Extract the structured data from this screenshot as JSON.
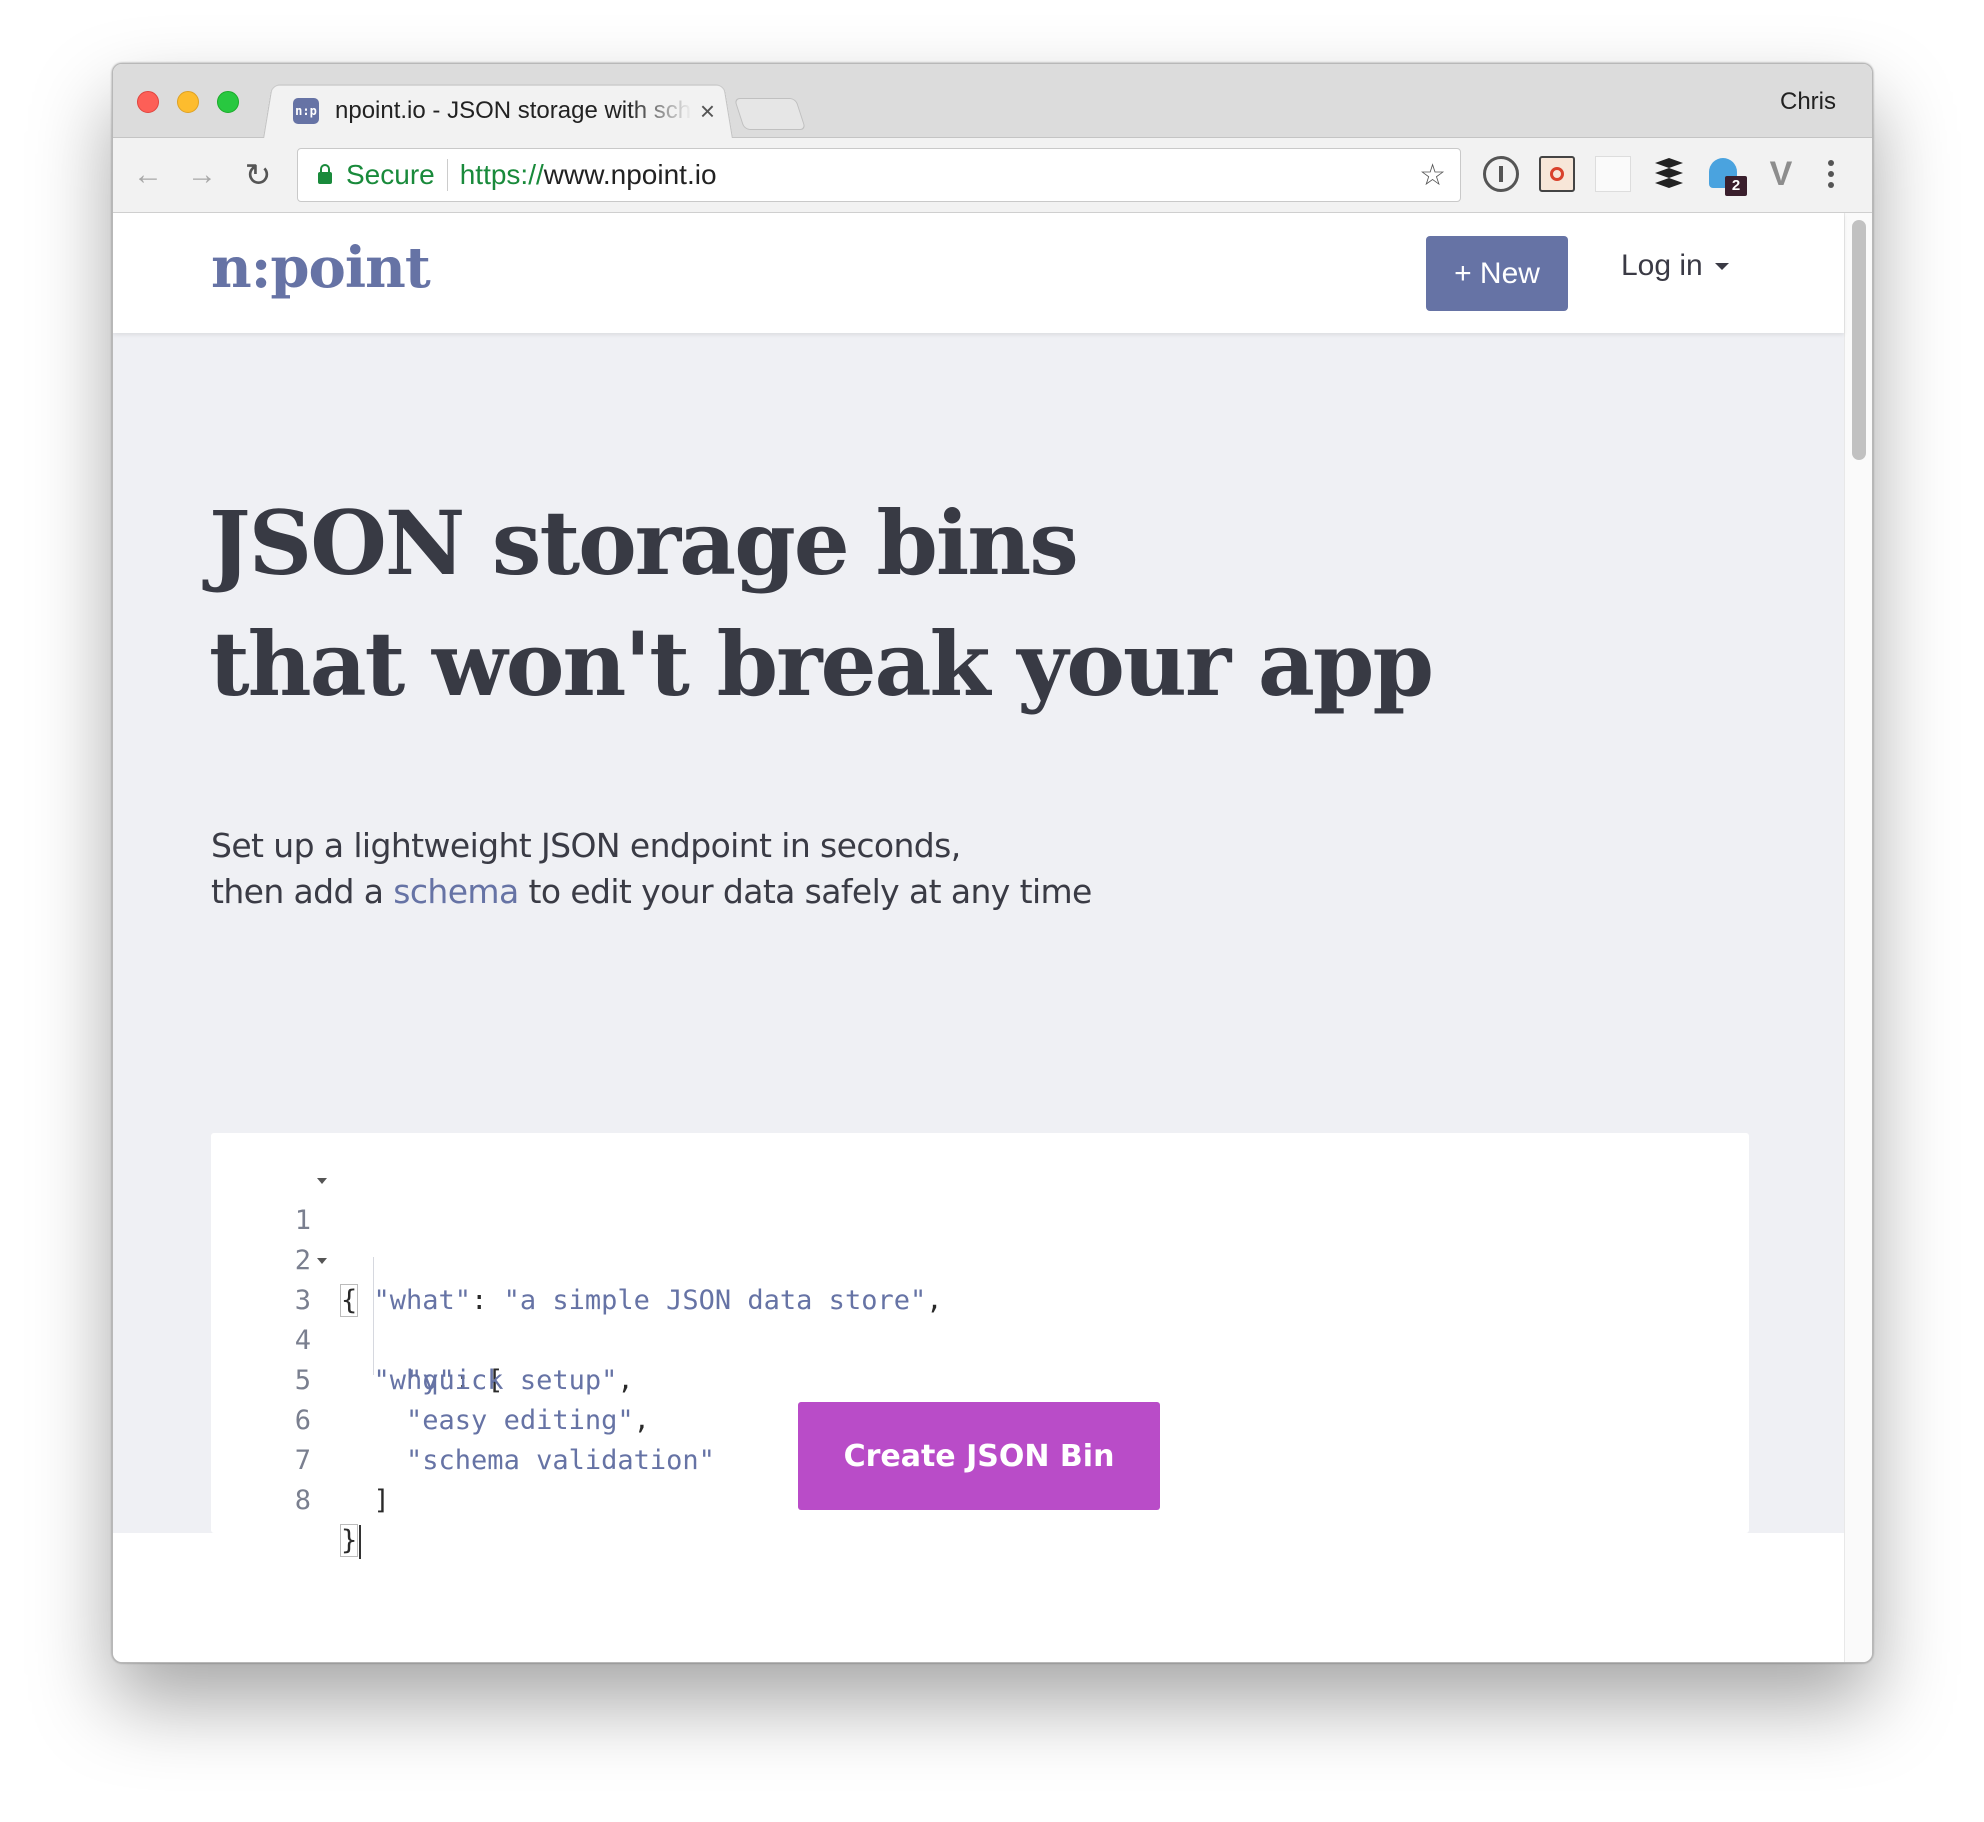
{
  "browser": {
    "tab_title": "npoint.io - JSON storage with schema validation",
    "tab_favicon": "n:p",
    "profile_name": "Chris",
    "secure_label": "Secure",
    "url_scheme": "https://",
    "url_host": "www.npoint.io",
    "extension_badge": "2",
    "icons": [
      "back-icon",
      "forward-icon",
      "reload-icon",
      "lock-icon",
      "star-icon",
      "onepassword-icon",
      "screenshot-icon",
      "document-icon",
      "layers-icon",
      "ghostery-icon",
      "vee-icon",
      "menu-icon"
    ]
  },
  "site_nav": {
    "logo": "n:point",
    "new_button": "+ New",
    "login_label": "Log in"
  },
  "hero": {
    "headline_line1": "JSON storage bins",
    "headline_line2": "that won't break your app",
    "subhead_line1": "Set up a lightweight JSON endpoint in seconds,",
    "subhead_line2_prefix": "then add a ",
    "subhead_link": "schema",
    "subhead_line2_suffix": " to edit your data safely at any time"
  },
  "editor": {
    "lines": [
      {
        "num": "1"
      },
      {
        "num": "2"
      },
      {
        "num": "3"
      },
      {
        "num": "4"
      },
      {
        "num": "5"
      },
      {
        "num": "6"
      },
      {
        "num": "7"
      },
      {
        "num": "8"
      }
    ],
    "code": {
      "open_brace": "{",
      "key_what": "\"what\"",
      "val_what": "\"a simple JSON data store\"",
      "key_why": "\"why\"",
      "item1": "\"quick setup\"",
      "item2": "\"easy editing\"",
      "item3": "\"schema validation\"",
      "close_bracket": "]",
      "close_brace": "}"
    }
  },
  "create_button": "Create JSON Bin",
  "colors": {
    "accent": "#6673a5",
    "create_button": "#b94cc8",
    "hero_bg": "#eff0f4",
    "secure_green": "#198a3b"
  }
}
